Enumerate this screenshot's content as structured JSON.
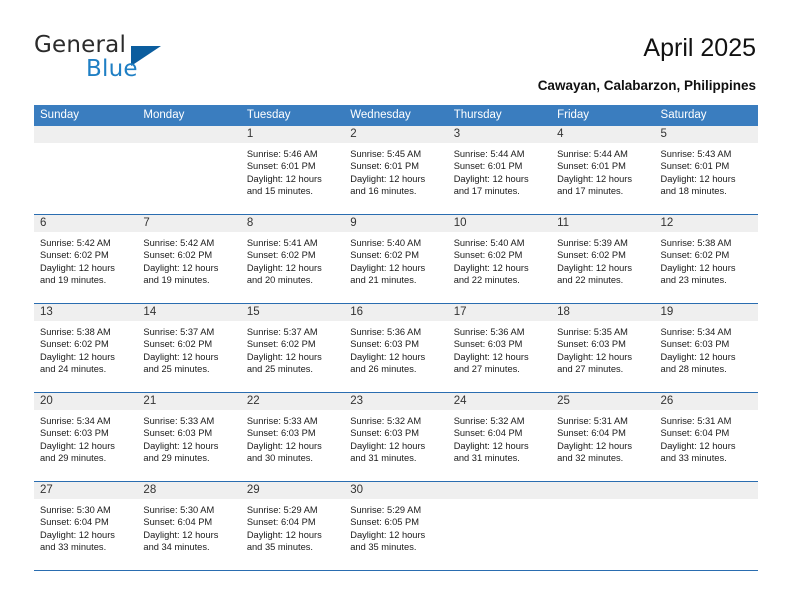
{
  "brand": {
    "name_top": "General",
    "name_bottom": "Blue",
    "triangle_color": "#0b5d9e",
    "blue_color": "#1f7fc4"
  },
  "header": {
    "title": "April 2025",
    "subtitle": "Cawayan, Calabarzon, Philippines"
  },
  "theme": {
    "header_bar": "#3a7dbf",
    "row_divider": "#2a6db0",
    "daynum_band": "#efefef"
  },
  "weekdays": [
    "Sunday",
    "Monday",
    "Tuesday",
    "Wednesday",
    "Thursday",
    "Friday",
    "Saturday"
  ],
  "weeks": [
    [
      {
        "day": "",
        "blank": true
      },
      {
        "day": "",
        "blank": true
      },
      {
        "day": "1",
        "sunrise": "Sunrise: 5:46 AM",
        "sunset": "Sunset: 6:01 PM",
        "daylight1": "Daylight: 12 hours",
        "daylight2": "and 15 minutes."
      },
      {
        "day": "2",
        "sunrise": "Sunrise: 5:45 AM",
        "sunset": "Sunset: 6:01 PM",
        "daylight1": "Daylight: 12 hours",
        "daylight2": "and 16 minutes."
      },
      {
        "day": "3",
        "sunrise": "Sunrise: 5:44 AM",
        "sunset": "Sunset: 6:01 PM",
        "daylight1": "Daylight: 12 hours",
        "daylight2": "and 17 minutes."
      },
      {
        "day": "4",
        "sunrise": "Sunrise: 5:44 AM",
        "sunset": "Sunset: 6:01 PM",
        "daylight1": "Daylight: 12 hours",
        "daylight2": "and 17 minutes."
      },
      {
        "day": "5",
        "sunrise": "Sunrise: 5:43 AM",
        "sunset": "Sunset: 6:01 PM",
        "daylight1": "Daylight: 12 hours",
        "daylight2": "and 18 minutes."
      }
    ],
    [
      {
        "day": "6",
        "sunrise": "Sunrise: 5:42 AM",
        "sunset": "Sunset: 6:02 PM",
        "daylight1": "Daylight: 12 hours",
        "daylight2": "and 19 minutes."
      },
      {
        "day": "7",
        "sunrise": "Sunrise: 5:42 AM",
        "sunset": "Sunset: 6:02 PM",
        "daylight1": "Daylight: 12 hours",
        "daylight2": "and 19 minutes."
      },
      {
        "day": "8",
        "sunrise": "Sunrise: 5:41 AM",
        "sunset": "Sunset: 6:02 PM",
        "daylight1": "Daylight: 12 hours",
        "daylight2": "and 20 minutes."
      },
      {
        "day": "9",
        "sunrise": "Sunrise: 5:40 AM",
        "sunset": "Sunset: 6:02 PM",
        "daylight1": "Daylight: 12 hours",
        "daylight2": "and 21 minutes."
      },
      {
        "day": "10",
        "sunrise": "Sunrise: 5:40 AM",
        "sunset": "Sunset: 6:02 PM",
        "daylight1": "Daylight: 12 hours",
        "daylight2": "and 22 minutes."
      },
      {
        "day": "11",
        "sunrise": "Sunrise: 5:39 AM",
        "sunset": "Sunset: 6:02 PM",
        "daylight1": "Daylight: 12 hours",
        "daylight2": "and 22 minutes."
      },
      {
        "day": "12",
        "sunrise": "Sunrise: 5:38 AM",
        "sunset": "Sunset: 6:02 PM",
        "daylight1": "Daylight: 12 hours",
        "daylight2": "and 23 minutes."
      }
    ],
    [
      {
        "day": "13",
        "sunrise": "Sunrise: 5:38 AM",
        "sunset": "Sunset: 6:02 PM",
        "daylight1": "Daylight: 12 hours",
        "daylight2": "and 24 minutes."
      },
      {
        "day": "14",
        "sunrise": "Sunrise: 5:37 AM",
        "sunset": "Sunset: 6:02 PM",
        "daylight1": "Daylight: 12 hours",
        "daylight2": "and 25 minutes."
      },
      {
        "day": "15",
        "sunrise": "Sunrise: 5:37 AM",
        "sunset": "Sunset: 6:02 PM",
        "daylight1": "Daylight: 12 hours",
        "daylight2": "and 25 minutes."
      },
      {
        "day": "16",
        "sunrise": "Sunrise: 5:36 AM",
        "sunset": "Sunset: 6:03 PM",
        "daylight1": "Daylight: 12 hours",
        "daylight2": "and 26 minutes."
      },
      {
        "day": "17",
        "sunrise": "Sunrise: 5:36 AM",
        "sunset": "Sunset: 6:03 PM",
        "daylight1": "Daylight: 12 hours",
        "daylight2": "and 27 minutes."
      },
      {
        "day": "18",
        "sunrise": "Sunrise: 5:35 AM",
        "sunset": "Sunset: 6:03 PM",
        "daylight1": "Daylight: 12 hours",
        "daylight2": "and 27 minutes."
      },
      {
        "day": "19",
        "sunrise": "Sunrise: 5:34 AM",
        "sunset": "Sunset: 6:03 PM",
        "daylight1": "Daylight: 12 hours",
        "daylight2": "and 28 minutes."
      }
    ],
    [
      {
        "day": "20",
        "sunrise": "Sunrise: 5:34 AM",
        "sunset": "Sunset: 6:03 PM",
        "daylight1": "Daylight: 12 hours",
        "daylight2": "and 29 minutes."
      },
      {
        "day": "21",
        "sunrise": "Sunrise: 5:33 AM",
        "sunset": "Sunset: 6:03 PM",
        "daylight1": "Daylight: 12 hours",
        "daylight2": "and 29 minutes."
      },
      {
        "day": "22",
        "sunrise": "Sunrise: 5:33 AM",
        "sunset": "Sunset: 6:03 PM",
        "daylight1": "Daylight: 12 hours",
        "daylight2": "and 30 minutes."
      },
      {
        "day": "23",
        "sunrise": "Sunrise: 5:32 AM",
        "sunset": "Sunset: 6:03 PM",
        "daylight1": "Daylight: 12 hours",
        "daylight2": "and 31 minutes."
      },
      {
        "day": "24",
        "sunrise": "Sunrise: 5:32 AM",
        "sunset": "Sunset: 6:04 PM",
        "daylight1": "Daylight: 12 hours",
        "daylight2": "and 31 minutes."
      },
      {
        "day": "25",
        "sunrise": "Sunrise: 5:31 AM",
        "sunset": "Sunset: 6:04 PM",
        "daylight1": "Daylight: 12 hours",
        "daylight2": "and 32 minutes."
      },
      {
        "day": "26",
        "sunrise": "Sunrise: 5:31 AM",
        "sunset": "Sunset: 6:04 PM",
        "daylight1": "Daylight: 12 hours",
        "daylight2": "and 33 minutes."
      }
    ],
    [
      {
        "day": "27",
        "sunrise": "Sunrise: 5:30 AM",
        "sunset": "Sunset: 6:04 PM",
        "daylight1": "Daylight: 12 hours",
        "daylight2": "and 33 minutes."
      },
      {
        "day": "28",
        "sunrise": "Sunrise: 5:30 AM",
        "sunset": "Sunset: 6:04 PM",
        "daylight1": "Daylight: 12 hours",
        "daylight2": "and 34 minutes."
      },
      {
        "day": "29",
        "sunrise": "Sunrise: 5:29 AM",
        "sunset": "Sunset: 6:04 PM",
        "daylight1": "Daylight: 12 hours",
        "daylight2": "and 35 minutes."
      },
      {
        "day": "30",
        "sunrise": "Sunrise: 5:29 AM",
        "sunset": "Sunset: 6:05 PM",
        "daylight1": "Daylight: 12 hours",
        "daylight2": "and 35 minutes."
      },
      {
        "day": "",
        "blank": true
      },
      {
        "day": "",
        "blank": true
      },
      {
        "day": "",
        "blank": true
      }
    ]
  ]
}
